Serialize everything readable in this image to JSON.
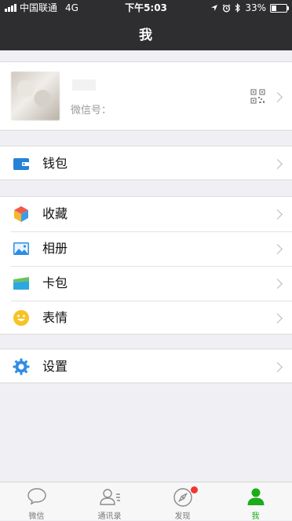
{
  "status_bar": {
    "carrier": "中国联通",
    "network": "4G",
    "time": "下午5:03",
    "battery": "33%"
  },
  "nav": {
    "title": "我"
  },
  "profile": {
    "wechat_id_label": "微信号："
  },
  "menu": {
    "wallet": "钱包",
    "favorites": "收藏",
    "album": "相册",
    "cards": "卡包",
    "stickers": "表情",
    "settings": "设置"
  },
  "tabbar": {
    "tabs": [
      {
        "label": "微信",
        "icon": "chat-icon"
      },
      {
        "label": "通讯录",
        "icon": "contacts-icon"
      },
      {
        "label": "发现",
        "icon": "discover-compass-icon"
      },
      {
        "label": "我",
        "icon": "me-icon"
      }
    ],
    "active_index": 3
  },
  "colors": {
    "accent": "#1aad19",
    "badge": "#f43530",
    "header": "#2e2e30"
  }
}
